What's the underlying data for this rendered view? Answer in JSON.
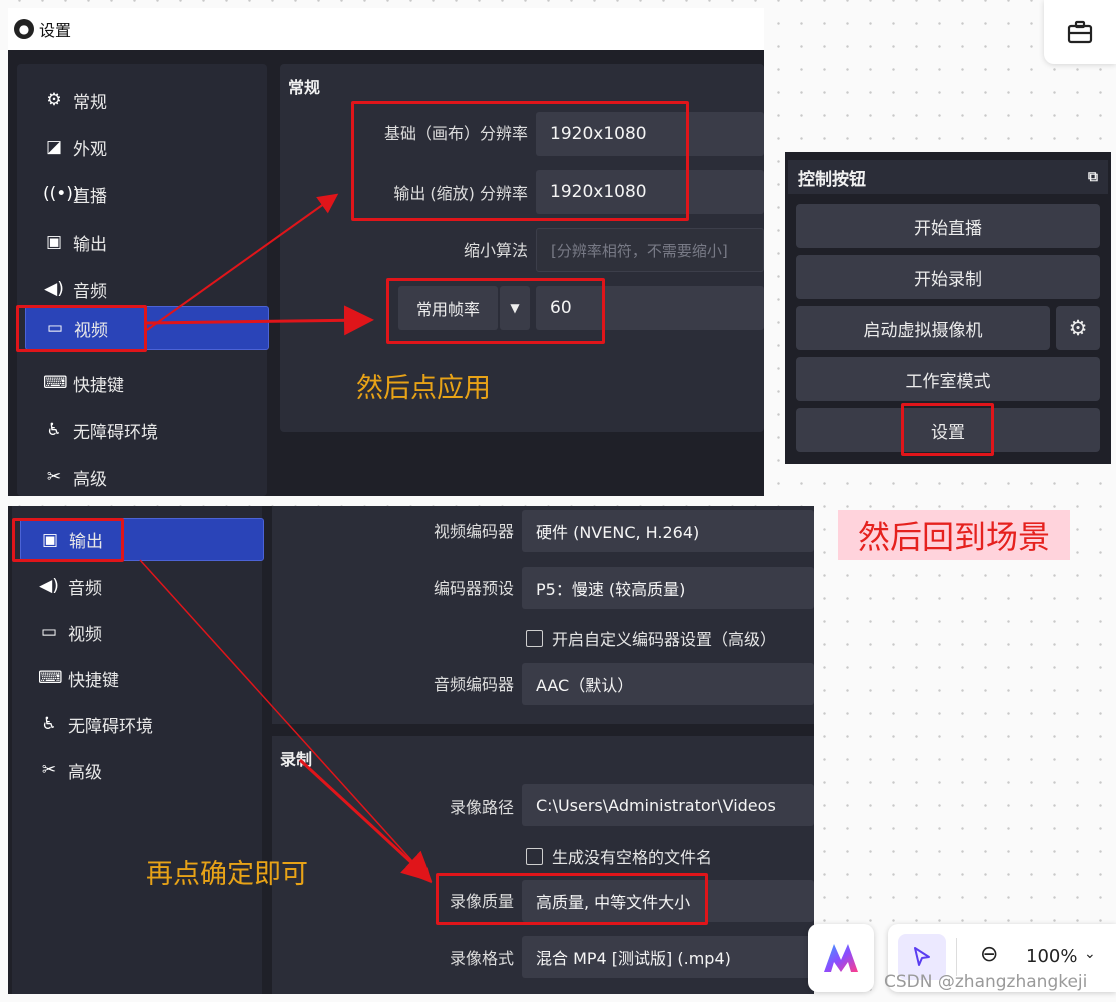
{
  "window1": {
    "title": "设置",
    "sidebar": [
      {
        "label": "常规",
        "icon": "gear-icon"
      },
      {
        "label": "外观",
        "icon": "appearance-icon"
      },
      {
        "label": "直播",
        "icon": "broadcast-icon"
      },
      {
        "label": "输出",
        "icon": "output-icon"
      },
      {
        "label": "音频",
        "icon": "speaker-icon"
      },
      {
        "label": "视频",
        "icon": "monitor-icon",
        "selected": true
      },
      {
        "label": "快捷键",
        "icon": "keyboard-icon"
      },
      {
        "label": "无障碍环境",
        "icon": "accessibility-icon"
      },
      {
        "label": "高级",
        "icon": "wrench-icon"
      }
    ],
    "section_title": "常规",
    "base_res_label": "基础（画布）分辨率",
    "base_res_value": "1920x1080",
    "output_res_label": "输出 (缩放) 分辨率",
    "output_res_value": "1920x1080",
    "downscale_label": "缩小算法",
    "downscale_value": "[分辨率相符，不需要缩小]",
    "fps_type": "常用帧率",
    "fps_value": "60",
    "annotation": "然后点应用"
  },
  "controls": {
    "title": "控制按钮",
    "buttons": [
      "开始直播",
      "开始录制",
      "启动虚拟摄像机",
      "工作室模式",
      "设置"
    ],
    "annotation": "然后回到场景"
  },
  "window2": {
    "sidebar": [
      {
        "label": "输出",
        "icon": "output-icon",
        "selected": true
      },
      {
        "label": "音频",
        "icon": "speaker-icon"
      },
      {
        "label": "视频",
        "icon": "monitor-icon"
      },
      {
        "label": "快捷键",
        "icon": "keyboard-icon"
      },
      {
        "label": "无障碍环境",
        "icon": "accessibility-icon"
      },
      {
        "label": "高级",
        "icon": "wrench-icon"
      }
    ],
    "video_encoder_label": "视频编码器",
    "video_encoder_value": "硬件 (NVENC, H.264)",
    "encoder_preset_label": "编码器预设",
    "encoder_preset_value": "P5：慢速 (较高质量)",
    "custom_encoder_checkbox": "开启自定义编码器设置（高级）",
    "audio_encoder_label": "音频编码器",
    "audio_encoder_value": "AAC（默认）",
    "record_section": "录制",
    "record_path_label": "录像路径",
    "record_path_value": "C:\\Users\\Administrator\\Videos",
    "nospace_checkbox": "生成没有空格的文件名",
    "record_quality_label": "录像质量",
    "record_quality_value": "高质量, 中等文件大小",
    "record_format_label": "录像格式",
    "record_format_value": "混合 MP4 [测试版] (.mp4)",
    "annotation": "再点确定即可"
  },
  "overlay": {
    "zoom": "100%",
    "watermark": "CSDN @zhangzhangkeji"
  },
  "colors": {
    "selected": "#2a44b8",
    "red_box": "#e0151a",
    "annotation": "#e8a317",
    "scene_note_bg": "#ffd3dc"
  }
}
